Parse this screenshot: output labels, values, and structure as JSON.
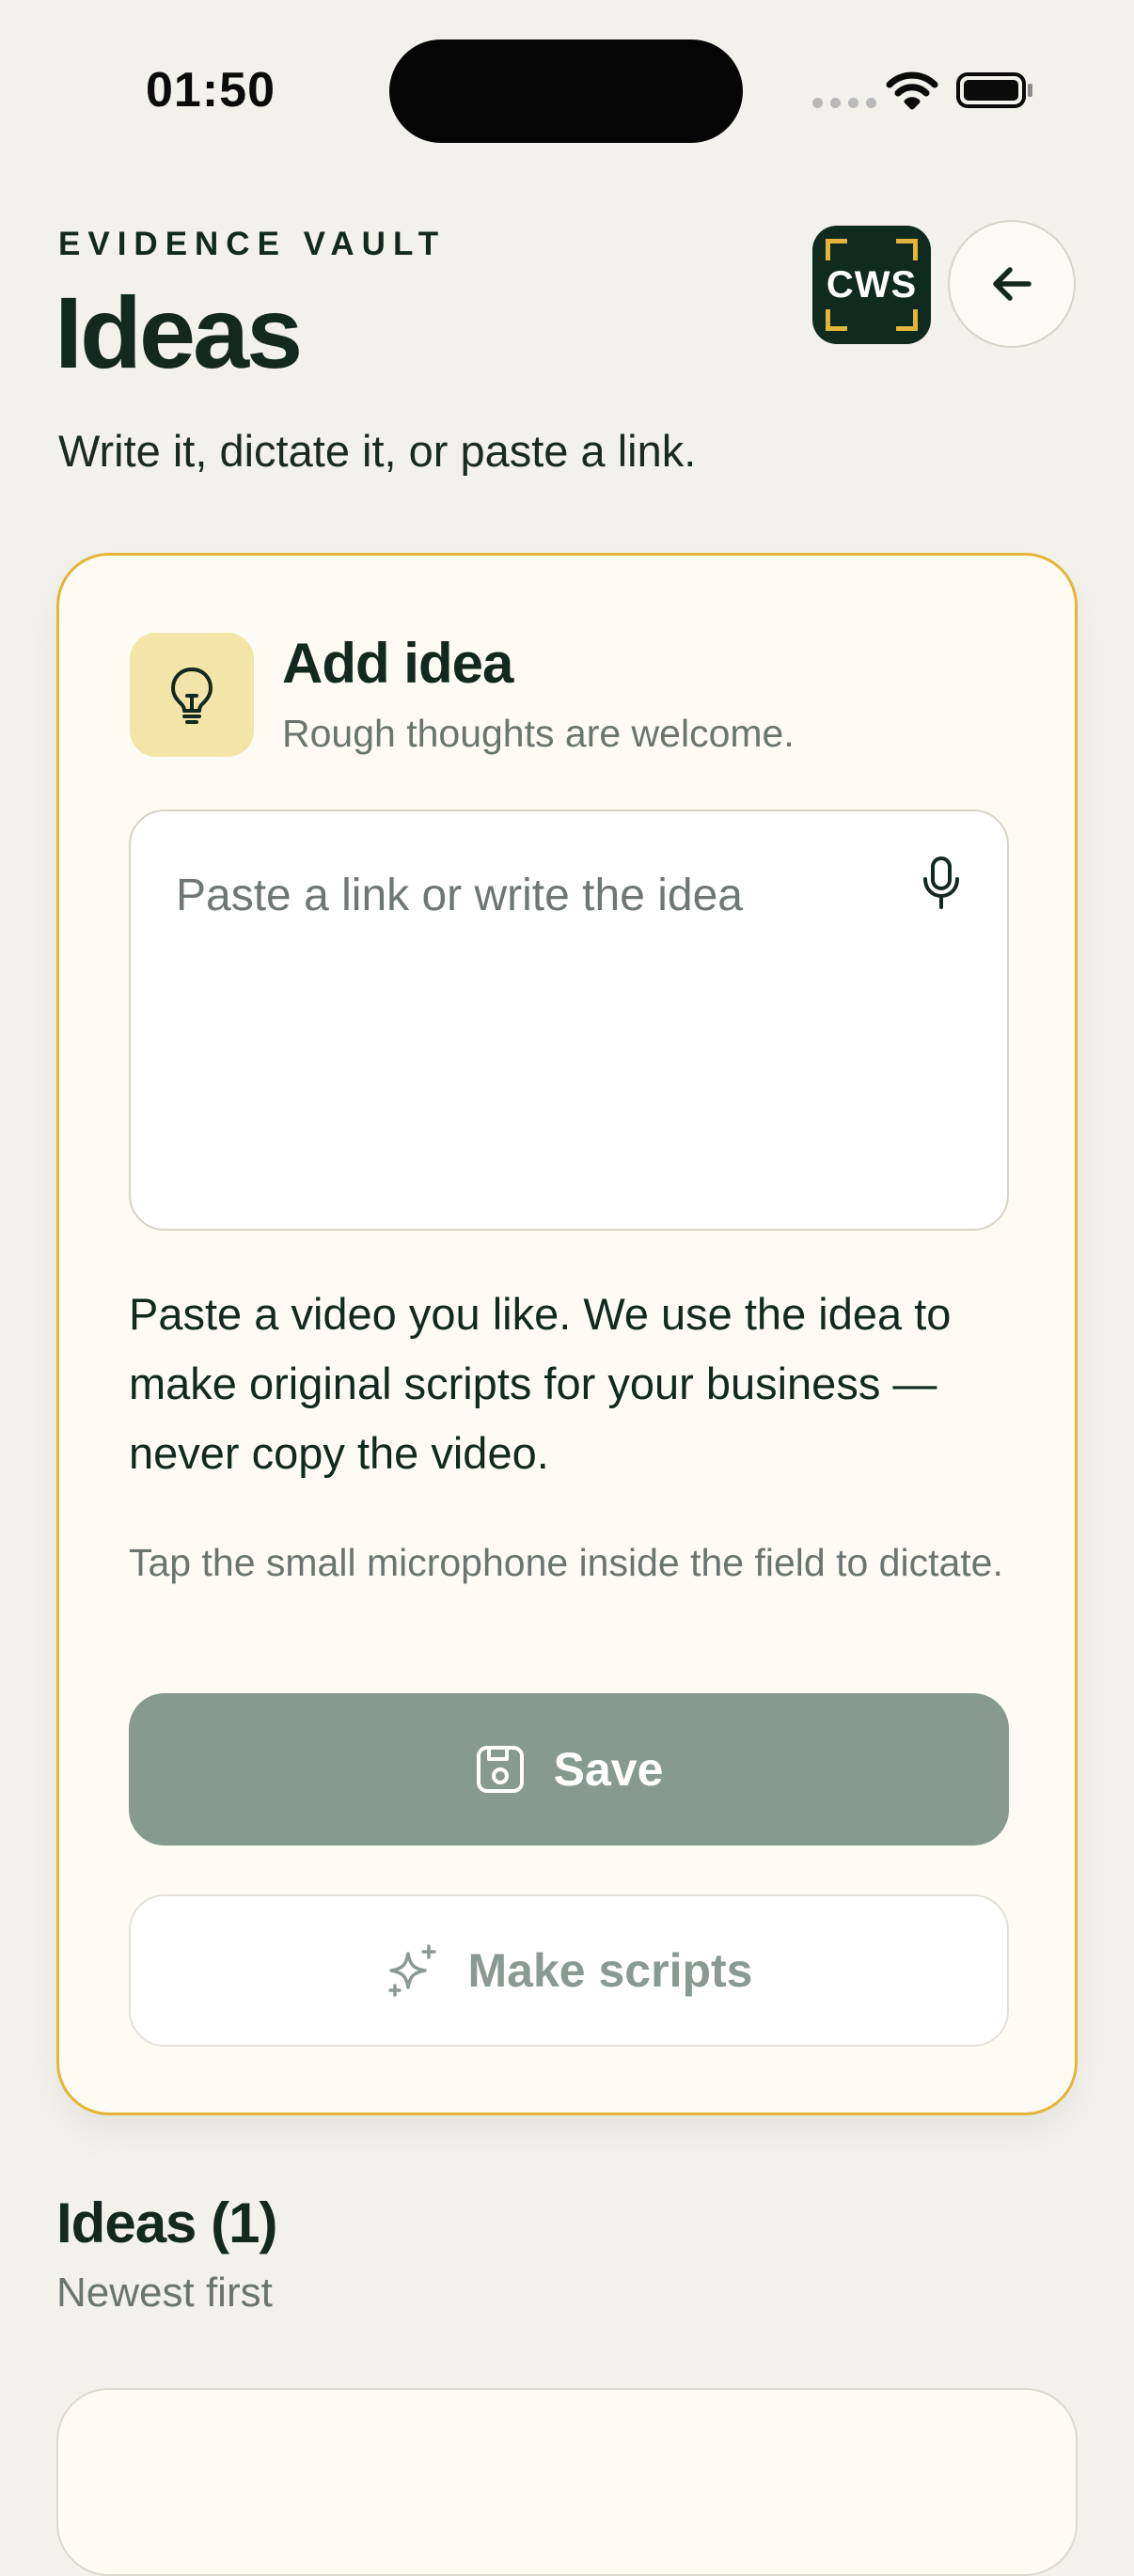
{
  "status_bar": {
    "time": "01:50"
  },
  "header": {
    "eyebrow": "EVIDENCE VAULT",
    "title": "Ideas",
    "subtitle": "Write it, dictate it, or paste a link.",
    "logo_text": "CWS"
  },
  "add_card": {
    "title": "Add idea",
    "subtitle": "Rough thoughts are welcome.",
    "input_value": "",
    "input_placeholder": "Paste a link or write the idea",
    "note": "Paste a video you like. We use the idea to make original scripts for your business — never copy the video.",
    "hint": "Tap the small microphone inside the field to dictate.",
    "save_label": "Save",
    "make_scripts_label": "Make scripts"
  },
  "ideas_list": {
    "title": "Ideas (1)",
    "subtitle": "Newest first"
  },
  "icons": {
    "status": [
      "signal-dots-icon",
      "wifi-icon",
      "battery-icon"
    ],
    "header": [
      "back-arrow-icon"
    ],
    "card": [
      "lightbulb-icon",
      "microphone-icon",
      "save-disk-icon",
      "sparkles-icon"
    ]
  },
  "colors": {
    "background": "#f2f1ec",
    "primary_text": "#13291f",
    "accent_border": "#e3b638",
    "save_button": "#869a90",
    "bulb_tile": "#f3e4a8",
    "logo_bg": "#0f2a1f"
  }
}
